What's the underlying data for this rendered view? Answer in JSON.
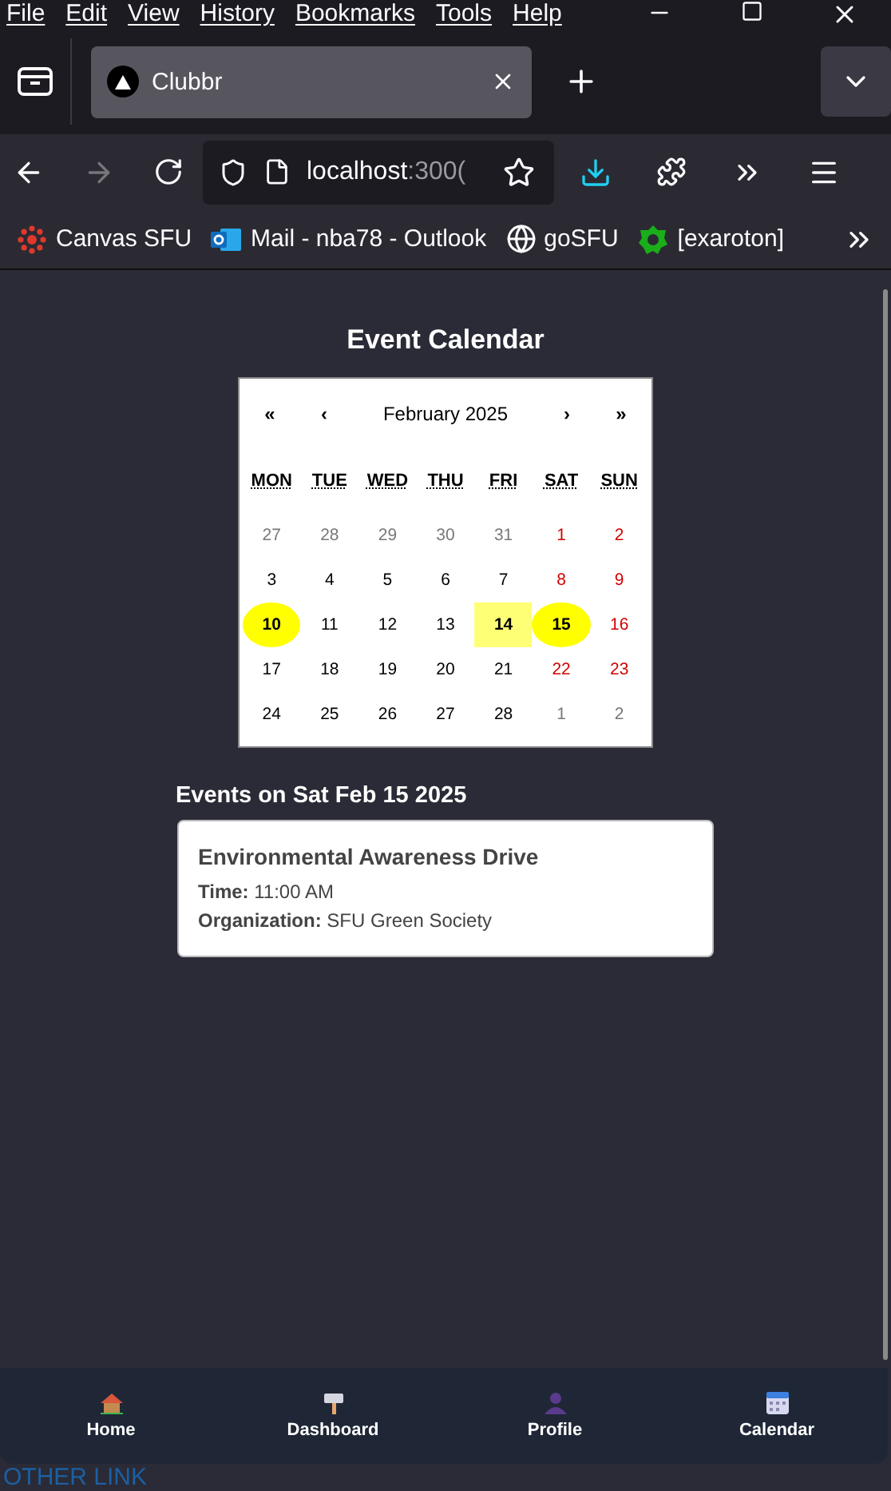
{
  "menu_bar": [
    "File",
    "Edit",
    "View",
    "History",
    "Bookmarks",
    "Tools",
    "Help"
  ],
  "tab": {
    "title": "Clubbr",
    "selected": true
  },
  "address_bar": {
    "host": "localhost",
    "rest": ":300("
  },
  "bookmarks": [
    {
      "label": "Canvas SFU",
      "kind": "canvas"
    },
    {
      "label": "Mail - nba78 - Outlook",
      "kind": "outlook"
    },
    {
      "label": "goSFU",
      "kind": "globe"
    },
    {
      "label": "[exaroton]",
      "kind": "gear"
    }
  ],
  "page_title": "Event Calendar",
  "calendar": {
    "nav": [
      "«",
      "‹",
      "February 2025",
      "›",
      "»"
    ],
    "weekdays": [
      "MON",
      "TUE",
      "WED",
      "THU",
      "FRI",
      "SAT",
      "SUN"
    ],
    "weeks": [
      [
        {
          "label": "27",
          "muted": true,
          "weekend": false,
          "event": false,
          "today": false
        },
        {
          "label": "28",
          "muted": true,
          "weekend": false,
          "event": false,
          "today": false
        },
        {
          "label": "29",
          "muted": true,
          "weekend": false,
          "event": false,
          "today": false
        },
        {
          "label": "30",
          "muted": true,
          "weekend": false,
          "event": false,
          "today": false
        },
        {
          "label": "31",
          "muted": true,
          "weekend": false,
          "event": false,
          "today": false
        },
        {
          "label": "1",
          "muted": false,
          "weekend": true,
          "event": false,
          "today": false
        },
        {
          "label": "2",
          "muted": false,
          "weekend": true,
          "event": false,
          "today": false
        }
      ],
      [
        {
          "label": "3",
          "muted": false,
          "weekend": false,
          "event": false,
          "today": false
        },
        {
          "label": "4",
          "muted": false,
          "weekend": false,
          "event": false,
          "today": false
        },
        {
          "label": "5",
          "muted": false,
          "weekend": false,
          "event": false,
          "today": false
        },
        {
          "label": "6",
          "muted": false,
          "weekend": false,
          "event": false,
          "today": false
        },
        {
          "label": "7",
          "muted": false,
          "weekend": false,
          "event": false,
          "today": false
        },
        {
          "label": "8",
          "muted": false,
          "weekend": true,
          "event": false,
          "today": false
        },
        {
          "label": "9",
          "muted": false,
          "weekend": true,
          "event": false,
          "today": false
        }
      ],
      [
        {
          "label": "10",
          "muted": false,
          "weekend": false,
          "event": true,
          "today": false
        },
        {
          "label": "11",
          "muted": false,
          "weekend": false,
          "event": false,
          "today": false
        },
        {
          "label": "12",
          "muted": false,
          "weekend": false,
          "event": false,
          "today": false
        },
        {
          "label": "13",
          "muted": false,
          "weekend": false,
          "event": false,
          "today": false
        },
        {
          "label": "14",
          "muted": false,
          "weekend": false,
          "event": false,
          "today": true
        },
        {
          "label": "15",
          "muted": false,
          "weekend": true,
          "event": true,
          "today": false
        },
        {
          "label": "16",
          "muted": false,
          "weekend": true,
          "event": false,
          "today": false
        }
      ],
      [
        {
          "label": "17",
          "muted": false,
          "weekend": false,
          "event": false,
          "today": false
        },
        {
          "label": "18",
          "muted": false,
          "weekend": false,
          "event": false,
          "today": false
        },
        {
          "label": "19",
          "muted": false,
          "weekend": false,
          "event": false,
          "today": false
        },
        {
          "label": "20",
          "muted": false,
          "weekend": false,
          "event": false,
          "today": false
        },
        {
          "label": "21",
          "muted": false,
          "weekend": false,
          "event": false,
          "today": false
        },
        {
          "label": "22",
          "muted": false,
          "weekend": true,
          "event": false,
          "today": false
        },
        {
          "label": "23",
          "muted": false,
          "weekend": true,
          "event": false,
          "today": false
        }
      ],
      [
        {
          "label": "24",
          "muted": false,
          "weekend": false,
          "event": false,
          "today": false
        },
        {
          "label": "25",
          "muted": false,
          "weekend": false,
          "event": false,
          "today": false
        },
        {
          "label": "26",
          "muted": false,
          "weekend": false,
          "event": false,
          "today": false
        },
        {
          "label": "27",
          "muted": false,
          "weekend": false,
          "event": false,
          "today": false
        },
        {
          "label": "28",
          "muted": false,
          "weekend": false,
          "event": false,
          "today": false
        },
        {
          "label": "1",
          "muted": true,
          "weekend": false,
          "event": false,
          "today": false
        },
        {
          "label": "2",
          "muted": true,
          "weekend": false,
          "event": false,
          "today": false
        }
      ]
    ]
  },
  "events_heading": "Events on Sat Feb 15 2025",
  "events": [
    {
      "title": "Environmental Awareness Drive",
      "details": [
        "**Time:** 11:00 AM",
        "**Organization:** SFU Green Society"
      ]
    }
  ],
  "bottom_nav": [
    {
      "label": "Home",
      "kind": "home"
    },
    {
      "label": "Dashboard",
      "kind": "sign"
    },
    {
      "label": "Profile",
      "kind": "person"
    },
    {
      "label": "Calendar",
      "kind": "calendar"
    }
  ],
  "footer_link": "OTHER LINK"
}
